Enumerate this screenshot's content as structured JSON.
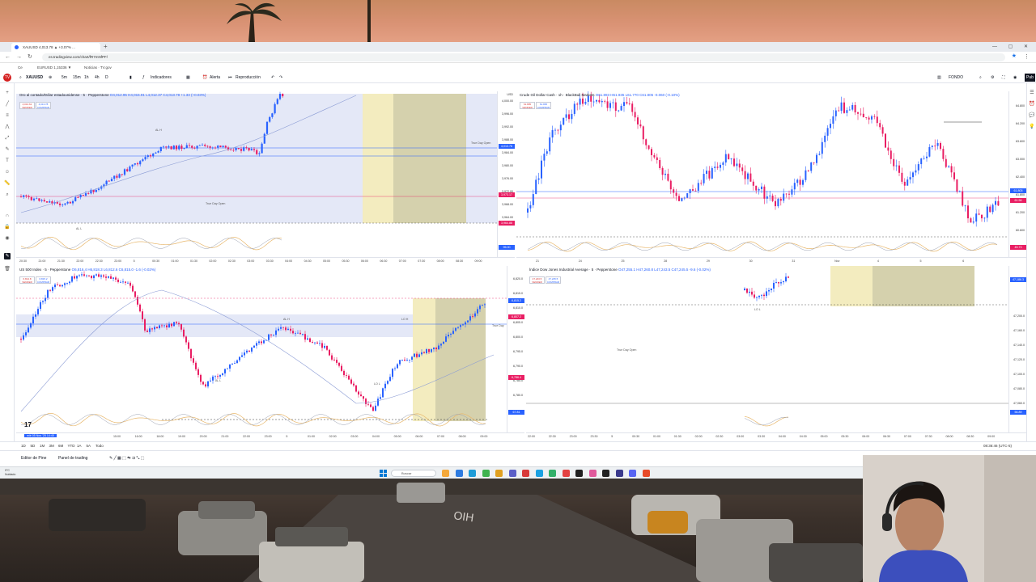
{
  "browser": {
    "tab_title": "XAUUSD 4,013.78 ▲ +3.07% ...",
    "new_tab": "+",
    "url": "es.tradingview.com/chart/fR7mNfPF/",
    "bookmarks": [
      "Ce",
      "EURUSD 1,15336 ▼",
      "Noticias · TV.gov"
    ]
  },
  "toolbar": {
    "symbol": "XAUUSD",
    "intervals": [
      "5m",
      "15m",
      "1h",
      "4h",
      "D"
    ],
    "indicators": "Indicadores",
    "alert": "Alerta",
    "replay": "Reproducción",
    "layout": "FONDO"
  },
  "panes": {
    "gold": {
      "title": "Oro al contado/Dólar estadounidense · 5 · Pepperstone",
      "ohlc": "O4,012.95 H4,015.91 L4,012.37 C4,013.78 +1.33 (+0.03%)",
      "sell": "4,013.61",
      "buy": "4,013.78",
      "currency": "USD",
      "price_ticks": [
        "4,000.00",
        "3,996.00",
        "3,992.00",
        "3,988.00",
        "3,984.00",
        "3,980.00",
        "3,976.00",
        "3,972.00",
        "3,968.00",
        "3,964.00"
      ],
      "labels": [
        "True Day Open",
        "True Day Open",
        "AL H",
        "AL L"
      ],
      "time_ticks": [
        "20:30",
        "21:00",
        "21:30",
        "22:00",
        "22:30",
        "23:00",
        "5",
        "00:30",
        "01:00",
        "01:30",
        "02:00",
        "02:30",
        "03:00",
        "03:30",
        "04:00",
        "04:30",
        "05:00",
        "05:30",
        "06:00",
        "06:30",
        "07:00",
        "07:30",
        "08:00",
        "08:30",
        "09:00"
      ]
    },
    "crude": {
      "title": "Crude Oil Dollar Cash · 1h · BlackBull Markets",
      "ohlc": "O61.893 H61.935 L61.770 C61.805 -0.060 (-0.10%)",
      "sell": "61.805",
      "buy": "61.835",
      "price_ticks": [
        "64.800",
        "64.200",
        "63.600",
        "63.000",
        "62.400",
        "61.800",
        "61.200",
        "60.600"
      ],
      "time_ticks": [
        "21",
        "24",
        "25",
        "28",
        "29",
        "30",
        "31",
        "Nov",
        "4",
        "5",
        "6"
      ]
    },
    "spx": {
      "title": "US 500 Index · 5 · Pepperstone",
      "ohlc": "O6,816.4 H6,818.3 L6,812.6 C6,815.0 -1.6 (-0.02%)",
      "sell": "6,814.8",
      "buy": "6,815.2",
      "price_ticks": [
        "6,820.0",
        "6,815.0",
        "6,810.0",
        "6,805.0",
        "6,800.0",
        "6,795.0",
        "6,790.0",
        "6,785.0",
        "6,780.0"
      ],
      "labels": [
        "True Day",
        "AL H",
        "LO H",
        "AL L",
        "LO L"
      ],
      "date_badge": "mié 05 Nov '25  14:40",
      "time_ticks": [
        "15:00",
        "16:00",
        "18:00",
        "19:00",
        "20:00",
        "21:00",
        "22:00",
        "23:00",
        "5",
        "01:00",
        "02:00",
        "03:00",
        "04:00",
        "05:00",
        "06:00",
        "07:00",
        "08:00",
        "09:00"
      ]
    },
    "dow": {
      "title": "Índice Dow Jones Industrial Average · 5 · Pepperstone",
      "ohlc": "O47,255.1 H47,260.8 L47,243.5 C47,245.5 -9.6 (-0.02%)",
      "sell": "47,243.5",
      "buy": "47,245.5",
      "price_ticks": [
        "47,200.0",
        "47,160.0",
        "47,140.0",
        "47,120.0",
        "47,100.0",
        "47,080.0",
        "47,060.0"
      ],
      "labels": [
        "True Day Open",
        "LO L"
      ],
      "time_ticks": [
        "22:00",
        "22:30",
        "23:00",
        "23:30",
        "5",
        "00:30",
        "01:00",
        "01:30",
        "02:00",
        "02:30",
        "03:00",
        "03:30",
        "04:00",
        "04:30",
        "05:00",
        "05:30",
        "06:00",
        "06:30",
        "07:00",
        "07:30",
        "08:00",
        "08:30",
        "09:00"
      ]
    }
  },
  "bottom_bar": {
    "ranges": [
      "1D",
      "5D",
      "1M",
      "3M",
      "6M",
      "YTD",
      "1A",
      "5A",
      "Todo"
    ],
    "clock": "08:36:46 (UTC-5)"
  },
  "bottom_panel": {
    "editor": "Editor de Pine",
    "trading": "Panel de trading"
  },
  "taskbar": {
    "weather_temp": "9°C",
    "weather_desc": "Nublado",
    "search": "Buscar"
  },
  "colors": {
    "bull": "#2962ff",
    "bear": "#e91e63",
    "zone_yellow": "#f3ecbf",
    "zone_olive": "#d5d1ad",
    "zone_blue": "#e4e8f7",
    "accent": "#2962ff"
  }
}
